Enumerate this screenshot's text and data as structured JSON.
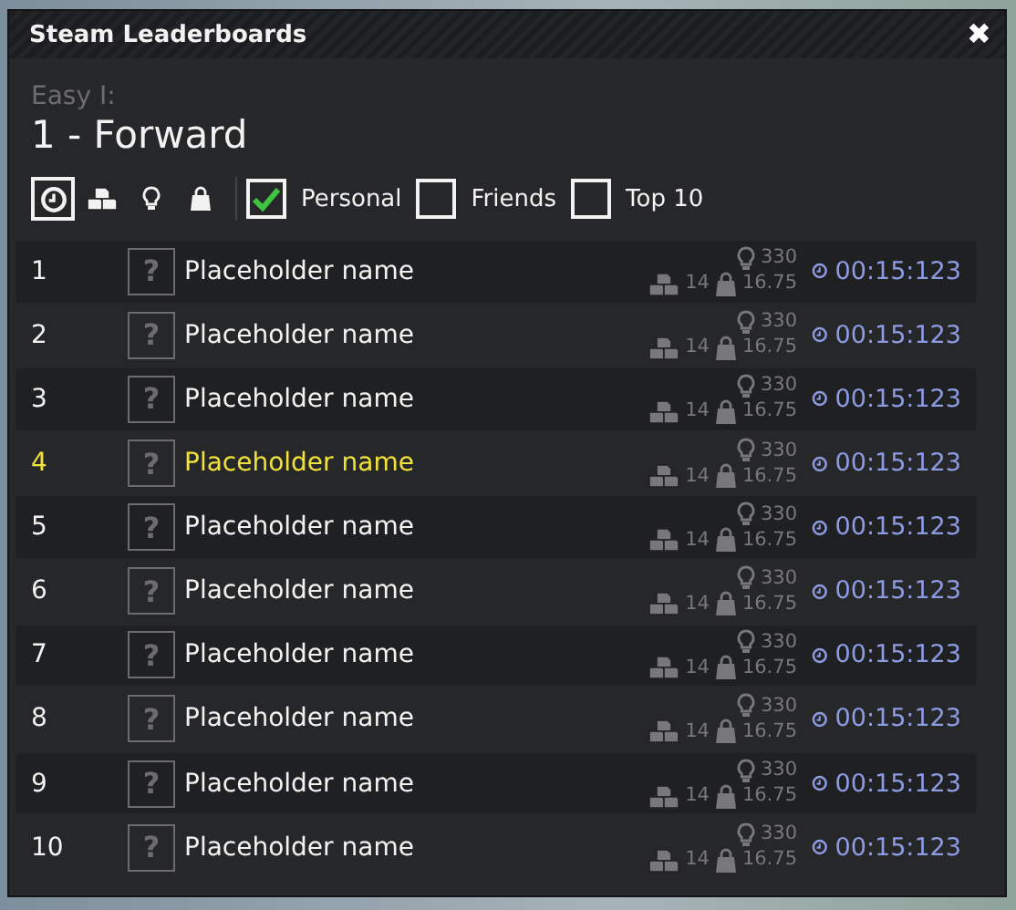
{
  "window": {
    "title": "Steam Leaderboards",
    "close": "✖"
  },
  "level": {
    "group": "Easy I:",
    "name": "1 - Forward"
  },
  "sort_options": [
    {
      "kind": "time",
      "selected": true
    },
    {
      "kind": "blocks",
      "selected": false
    },
    {
      "kind": "hints",
      "selected": false
    },
    {
      "kind": "weight",
      "selected": false
    }
  ],
  "filters": [
    {
      "label": "Personal",
      "checked": true
    },
    {
      "label": "Friends",
      "checked": false
    },
    {
      "label": "Top 10",
      "checked": false
    }
  ],
  "rows": [
    {
      "rank": "1",
      "avatar": "?",
      "name": "Placeholder name",
      "hints": "330",
      "blocks": "14",
      "weight": "16.75",
      "time": "00:15:123",
      "highlighted": false
    },
    {
      "rank": "2",
      "avatar": "?",
      "name": "Placeholder name",
      "hints": "330",
      "blocks": "14",
      "weight": "16.75",
      "time": "00:15:123",
      "highlighted": false
    },
    {
      "rank": "3",
      "avatar": "?",
      "name": "Placeholder name",
      "hints": "330",
      "blocks": "14",
      "weight": "16.75",
      "time": "00:15:123",
      "highlighted": false
    },
    {
      "rank": "4",
      "avatar": "?",
      "name": "Placeholder name",
      "hints": "330",
      "blocks": "14",
      "weight": "16.75",
      "time": "00:15:123",
      "highlighted": true
    },
    {
      "rank": "5",
      "avatar": "?",
      "name": "Placeholder name",
      "hints": "330",
      "blocks": "14",
      "weight": "16.75",
      "time": "00:15:123",
      "highlighted": false
    },
    {
      "rank": "6",
      "avatar": "?",
      "name": "Placeholder name",
      "hints": "330",
      "blocks": "14",
      "weight": "16.75",
      "time": "00:15:123",
      "highlighted": false
    },
    {
      "rank": "7",
      "avatar": "?",
      "name": "Placeholder name",
      "hints": "330",
      "blocks": "14",
      "weight": "16.75",
      "time": "00:15:123",
      "highlighted": false
    },
    {
      "rank": "8",
      "avatar": "?",
      "name": "Placeholder name",
      "hints": "330",
      "blocks": "14",
      "weight": "16.75",
      "time": "00:15:123",
      "highlighted": false
    },
    {
      "rank": "9",
      "avatar": "?",
      "name": "Placeholder name",
      "hints": "330",
      "blocks": "14",
      "weight": "16.75",
      "time": "00:15:123",
      "highlighted": false
    },
    {
      "rank": "10",
      "avatar": "?",
      "name": "Placeholder name",
      "hints": "330",
      "blocks": "14",
      "weight": "16.75",
      "time": "00:15:123",
      "highlighted": false
    }
  ]
}
